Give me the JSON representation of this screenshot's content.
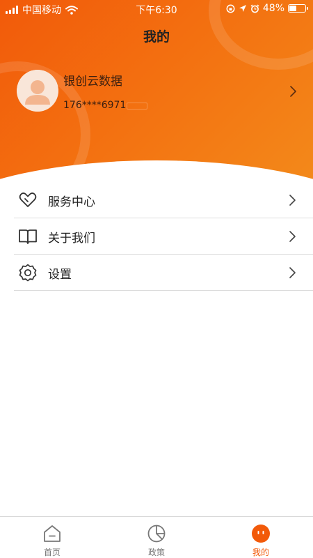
{
  "status_bar": {
    "carrier": "中国移动",
    "time": "下午6:30",
    "battery": "48%",
    "battery_level": 0.48
  },
  "header": {
    "title": "我的"
  },
  "profile": {
    "name": "银创云数据",
    "phone": "176****6971"
  },
  "menu": {
    "items": [
      {
        "label": "服务中心",
        "icon": "heart-icon"
      },
      {
        "label": "关于我们",
        "icon": "book-icon"
      },
      {
        "label": "设置",
        "icon": "gear-icon"
      }
    ]
  },
  "tabbar": {
    "tabs": [
      {
        "label": "首页",
        "icon": "home-icon",
        "active": false
      },
      {
        "label": "政策",
        "icon": "pie-chart-icon",
        "active": false
      },
      {
        "label": "我的",
        "icon": "profile-icon",
        "active": true
      }
    ]
  },
  "colors": {
    "accent": "#f25a0a",
    "header_gradient_start": "#f25a0a",
    "header_gradient_end": "#f3891a",
    "divider": "#dcdcdc",
    "tab_inactive": "#777777"
  }
}
